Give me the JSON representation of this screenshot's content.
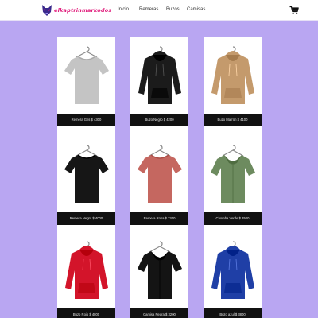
{
  "brand": {
    "name": "elkaptrinmarkodos",
    "accent": "#e0197a"
  },
  "nav": {
    "links": [
      "Inicio",
      "Remeras",
      "Buzos",
      "Camisas"
    ],
    "cart_icon": "shopping-cart-icon"
  },
  "colors": {
    "background": "#b9a6f2",
    "caption_bg": "#111111"
  },
  "products": [
    {
      "label": "Remera Gris $ 4300",
      "kind": "tshirt",
      "color": "#c4c4c4"
    },
    {
      "label": "Buzo Negro $ 4200",
      "kind": "hoodie",
      "color": "#1b1b1b"
    },
    {
      "label": "Buzo Marrón $ 4100",
      "kind": "hoodie",
      "color": "#c49a6c"
    },
    {
      "label": "Remera Negra $ 4000",
      "kind": "tshirt",
      "color": "#161616"
    },
    {
      "label": "Remera Rosa $ 2300",
      "kind": "tshirt",
      "color": "#c56760"
    },
    {
      "label": "Chomba Verde $ 3500",
      "kind": "shirt",
      "color": "#6d8b5f"
    },
    {
      "label": "Buzo Rojo $ 4800",
      "kind": "hoodie",
      "color": "#d3142a"
    },
    {
      "label": "Camisa Negra $ 3200",
      "kind": "shirt",
      "color": "#141414"
    },
    {
      "label": "Buzo azul $ 3800",
      "kind": "hoodie",
      "color": "#1f3fa6"
    }
  ]
}
